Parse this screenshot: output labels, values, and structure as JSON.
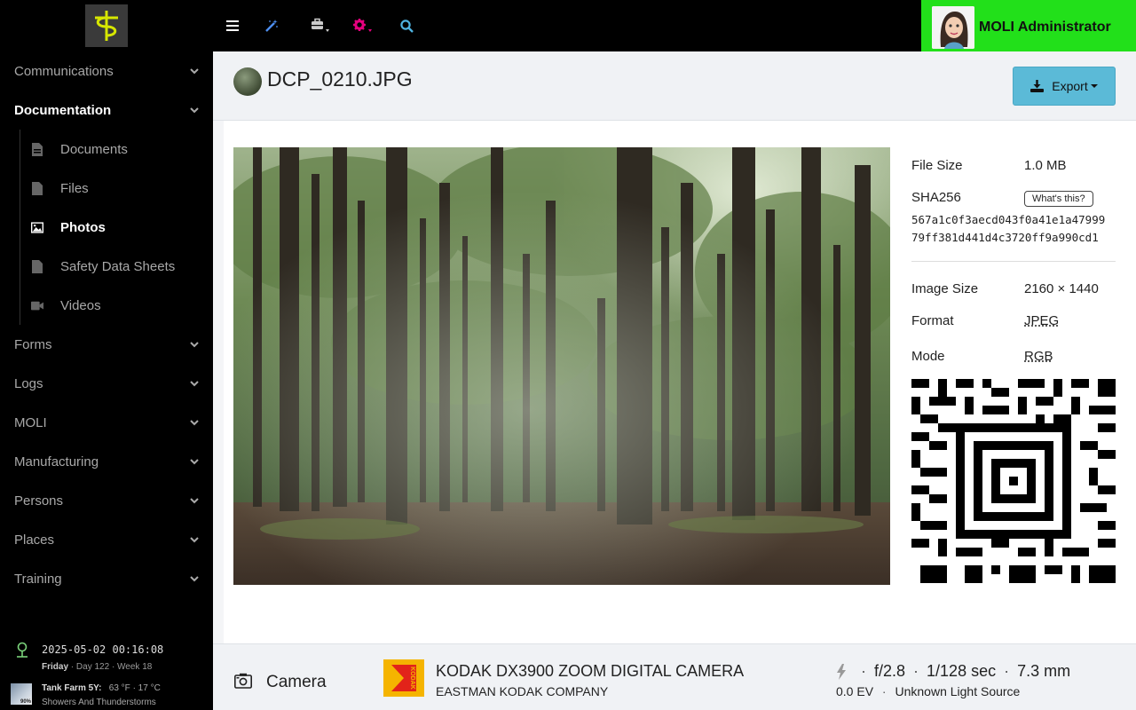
{
  "sidebar": {
    "nav": [
      {
        "label": "Communications"
      },
      {
        "label": "Documentation"
      },
      {
        "label": "Forms"
      },
      {
        "label": "Logs"
      },
      {
        "label": "MOLI"
      },
      {
        "label": "Manufacturing"
      },
      {
        "label": "Persons"
      },
      {
        "label": "Places"
      },
      {
        "label": "Training"
      }
    ],
    "documentation_sub": [
      {
        "label": "Documents",
        "icon": "document-icon"
      },
      {
        "label": "Files",
        "icon": "file-icon"
      },
      {
        "label": "Photos",
        "icon": "image-icon"
      },
      {
        "label": "Safety Data Sheets",
        "icon": "file-icon"
      },
      {
        "label": "Videos",
        "icon": "video-icon"
      }
    ],
    "clock": {
      "datetime": "2025-05-02 00:16:08",
      "day": "Friday",
      "day_of_year": "Day 122",
      "week": "Week 18"
    },
    "weather": {
      "location": "Tank Farm 5Y:",
      "temps": "63 °F · 17 °C",
      "condition": "Showers And Thunderstorms",
      "badge": "90%"
    }
  },
  "topbar": {
    "user_name": "MOLI Administrator",
    "accent": "#22e01a"
  },
  "page": {
    "title": "DCP_0210.JPG",
    "export_label": "Export"
  },
  "meta": {
    "file_size_label": "File Size",
    "file_size": "1.0 MB",
    "sha_label": "SHA256",
    "whats_this": "What's this?",
    "sha_line1": "567a1c0f3aecd043f0a41e1a47999",
    "sha_line2": "79ff381d441d4c3720ff9a990cd1",
    "image_size_label": "Image Size",
    "image_size": "2160 × 1440",
    "format_label": "Format",
    "format": "JPEG",
    "mode_label": "Mode",
    "mode": "RGB"
  },
  "camera": {
    "label": "Camera",
    "model": "KODAK DX3900 ZOOM DIGITAL CAMERA",
    "make": "EASTMAN KODAK COMPANY",
    "aperture": "f/2.8",
    "shutter": "1/128 sec",
    "focal_length": "7.3 mm",
    "exposure_bias": "0.0 EV",
    "light_source": "Unknown Light Source",
    "brand_logo_text": "KODAK"
  }
}
